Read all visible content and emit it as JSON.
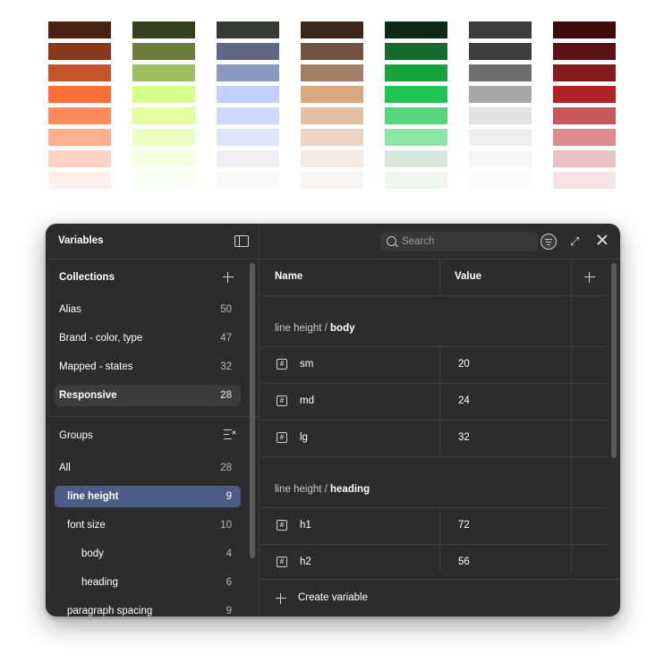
{
  "palette": {
    "columns": [
      [
        "#4a2314",
        "#8a3a1b",
        "#c4542a",
        "#ff6e34",
        "#ff8a5e",
        "#ffae90",
        "#ffd3c4",
        "#fff0ea"
      ],
      [
        "#343f1e",
        "#6a7d3d",
        "#9cbe5e",
        "#d7ff8c",
        "#e2ffa0",
        "#ecffc3",
        "#f4ffe3",
        "#fafff4"
      ],
      [
        "#363b34",
        "#606984",
        "#8a97c1",
        "#c3d0ff",
        "#cfd9ff",
        "#dde5fb",
        "#eef0f5",
        "#f8f9fb"
      ],
      [
        "#3a281b",
        "#705343",
        "#a27f64",
        "#d8a87f",
        "#e2c0a4",
        "#ecd6c3",
        "#f4e8df",
        "#faf4f0"
      ],
      [
        "#0e2a12",
        "#176a2c",
        "#17a43f",
        "#1fc552",
        "#56d57b",
        "#8de4a6",
        "#d7e7da",
        "#eef6f0"
      ],
      [
        "#3c3c3c",
        "#3f3f3f",
        "#6f6f6f",
        "#a8a8a8",
        "#e2e2e2",
        "#eeeeee",
        "#f6f6f6",
        "#fbfbfb"
      ],
      [
        "#3d0b0c",
        "#5d1316",
        "#861b1f",
        "#b42226",
        "#c8585c",
        "#db8a8d",
        "#ebc2c4",
        "#f6e3e4"
      ]
    ]
  },
  "panel": {
    "title": "Variables",
    "collections": {
      "title": "Collections",
      "items": [
        {
          "label": "Alias",
          "count": "50"
        },
        {
          "label": "Brand - color, type",
          "count": "47"
        },
        {
          "label": "Mapped - states",
          "count": "32"
        },
        {
          "label": "Responsive",
          "count": "28"
        }
      ]
    },
    "groups": {
      "title": "Groups",
      "items": [
        {
          "label": "All",
          "count": "28"
        },
        {
          "label": "line height",
          "count": "9"
        },
        {
          "label": "font size",
          "count": "10"
        },
        {
          "label": "body",
          "count": "4"
        },
        {
          "label": "heading",
          "count": "6"
        },
        {
          "label": "paragraph spacing",
          "count": "9"
        }
      ]
    },
    "search": {
      "placeholder": "Search",
      "value": ""
    },
    "table": {
      "columns": [
        "Name",
        "Value"
      ],
      "groups": [
        {
          "prefix": "line height / ",
          "name": "body",
          "rows": [
            {
              "name": "sm",
              "value": "20"
            },
            {
              "name": "md",
              "value": "24"
            },
            {
              "name": "lg",
              "value": "32"
            }
          ]
        },
        {
          "prefix": "line height / ",
          "name": "heading",
          "rows": [
            {
              "name": "h1",
              "value": "72"
            },
            {
              "name": "h2",
              "value": "56"
            }
          ]
        }
      ]
    },
    "footer": {
      "create_label": "Create variable"
    },
    "icons": {
      "sidebar_toggle": "sidebar-toggle-icon",
      "add": "plus-icon",
      "groups_sort": "list-sort-icon",
      "search": "search-icon",
      "filter": "filter-icon",
      "expand": "expand-icon",
      "close": "close-icon",
      "variable": "number-variable-icon"
    }
  }
}
